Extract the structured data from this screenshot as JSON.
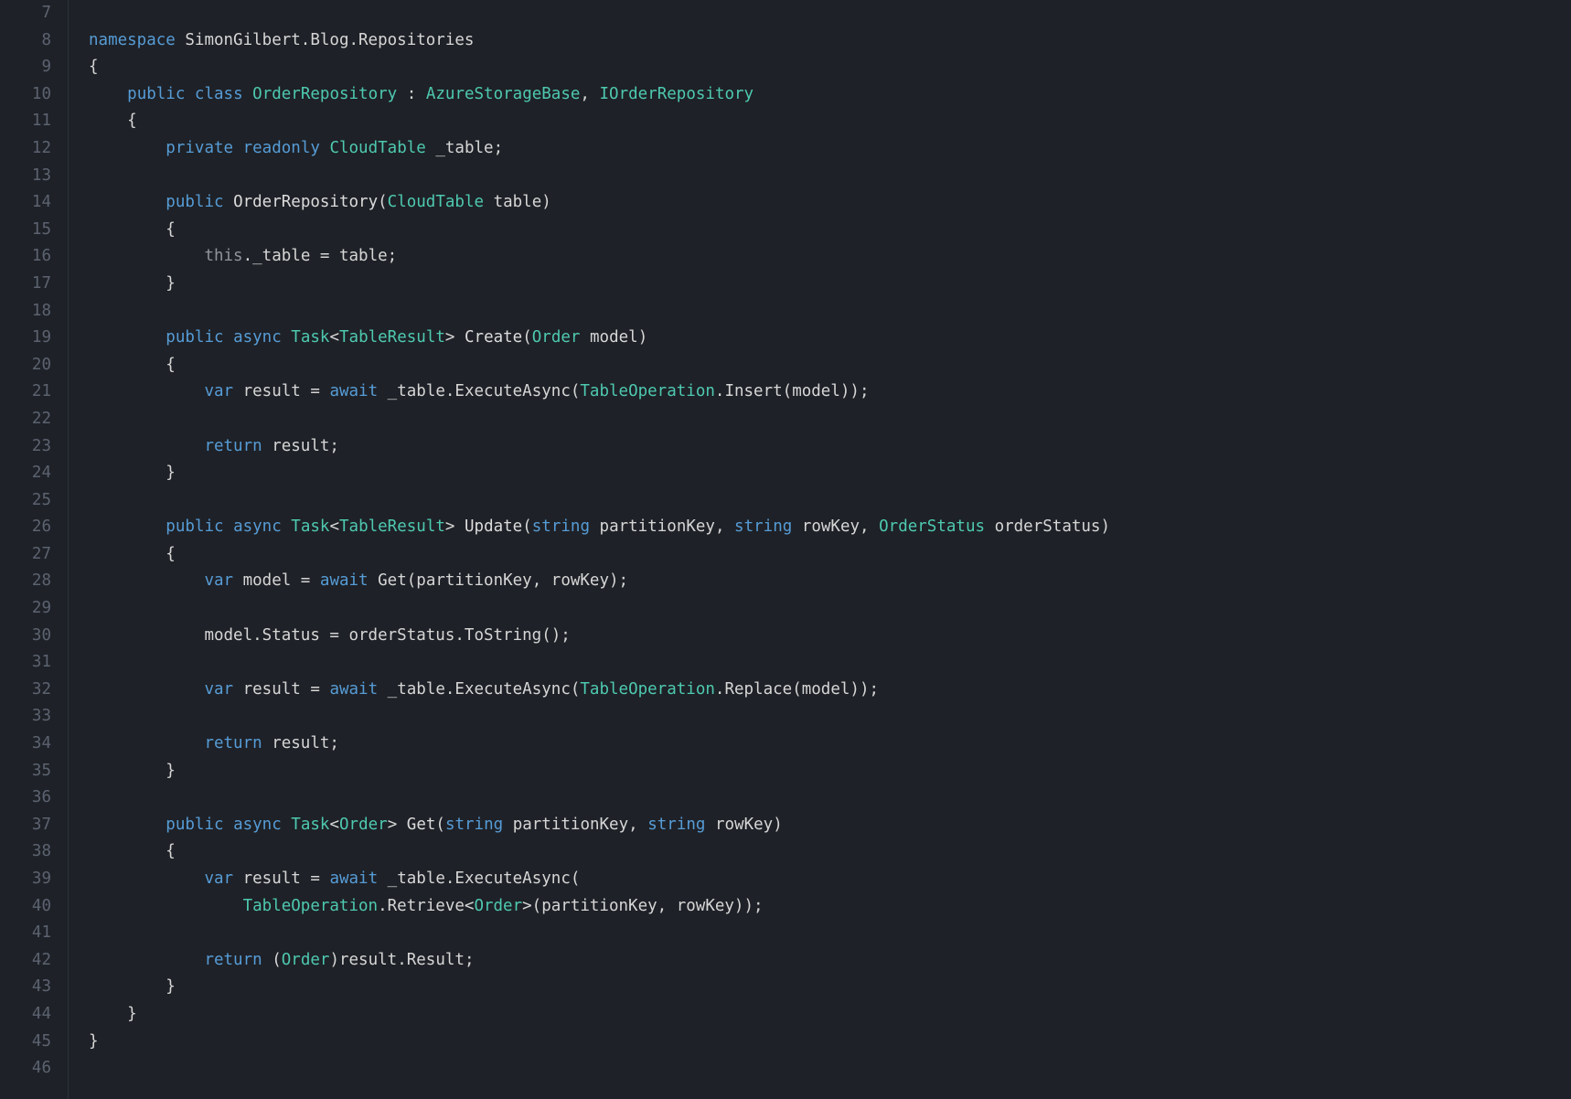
{
  "startLine": 7,
  "lines": [
    "",
    "<k>namespace</k> <id>SimonGilbert.Blog.Repositories</id>",
    "<br>{</br>",
    "    <k>public</k> <k>class</k> <ty>OrderRepository</ty> <p>:</p> <ty>AzureStorageBase</ty><p>,</p> <ty>IOrderRepository</ty>",
    "    <br>{</br>",
    "        <k>private</k> <k>readonly</k> <ty>CloudTable</ty> <id>_table;</id>",
    "",
    "        <k>public</k> <mth>OrderRepository</mth><p>(</p><ty>CloudTable</ty> <id>table</id><p>)</p>",
    "        <br>{</br>",
    "            <th>this</th><p>.</p><id>_table = table;</id>",
    "        <br>}</br>",
    "",
    "        <k>public</k> <k>async</k> <ty>Task</ty><p>&lt;</p><ty>TableResult</ty><p>&gt;</p> <mth>Create</mth><p>(</p><ty>Order</ty> <id>model</id><p>)</p>",
    "        <br>{</br>",
    "            <k>var</k> <id>result =</id> <k>await</k> <id>_table.ExecuteAsync(</id><ty>TableOperation</ty><id>.Insert(model));</id>",
    "",
    "            <k>return</k> <id>result;</id>",
    "        <br>}</br>",
    "",
    "        <k>public</k> <k>async</k> <ty>Task</ty><p>&lt;</p><ty>TableResult</ty><p>&gt;</p> <mth>Update</mth><p>(</p><k>string</k> <id>partitionKey,</id> <k>string</k> <id>rowKey,</id> <ty>OrderStatus</ty> <id>orderStatus</id><p>)</p>",
    "        <br>{</br>",
    "            <k>var</k> <id>model =</id> <k>await</k> <id>Get(partitionKey, rowKey);</id>",
    "",
    "            <id>model.Status = orderStatus.ToString();</id>",
    "",
    "            <k>var</k> <id>result =</id> <k>await</k> <id>_table.ExecuteAsync(</id><ty>TableOperation</ty><id>.Replace(model));</id>",
    "",
    "            <k>return</k> <id>result;</id>",
    "        <br>}</br>",
    "",
    "        <k>public</k> <k>async</k> <ty>Task</ty><p>&lt;</p><ty>Order</ty><p>&gt;</p> <mth>Get</mth><p>(</p><k>string</k> <id>partitionKey,</id> <k>string</k> <id>rowKey</id><p>)</p>",
    "        <br>{</br>",
    "            <k>var</k> <id>result =</id> <k>await</k> <id>_table.ExecuteAsync(</id>",
    "                <ty>TableOperation</ty><id>.Retrieve&lt;</id><ty>Order</ty><id>&gt;(partitionKey, rowKey));</id>",
    "",
    "            <k>return</k> <p>(</p><ty>Order</ty><p>)</p><id>result.Result;</id>",
    "        <br>}</br>",
    "    <br>}</br>",
    "<br>}</br>",
    ""
  ]
}
